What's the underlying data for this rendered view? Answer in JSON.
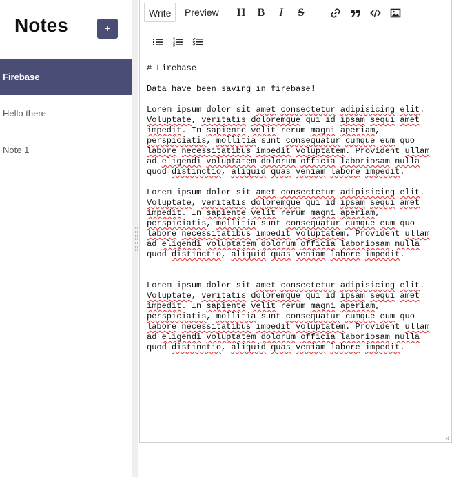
{
  "sidebar": {
    "title": "Notes",
    "add_label": "+",
    "notes": [
      {
        "label": "Firebase",
        "active": true
      },
      {
        "label": "Hello there",
        "active": false
      },
      {
        "label": "Note 1",
        "active": false
      }
    ]
  },
  "editor": {
    "tabs": [
      {
        "label": "Write",
        "active": true
      },
      {
        "label": "Preview",
        "active": false
      }
    ],
    "toolbar_icons": [
      "heading-icon",
      "bold-icon",
      "italic-icon",
      "strikethrough-icon",
      "link-icon",
      "quote-icon",
      "code-icon",
      "image-icon",
      "unordered-list-icon",
      "ordered-list-icon",
      "checked-list-icon"
    ],
    "toolbar_glyphs": {
      "heading": "H",
      "bold": "B",
      "italic": "I",
      "strike": "S"
    },
    "lines": [
      "# Firebase",
      "",
      "Data have been saving in firebase!",
      "",
      "Lorem ipsum dolor sit amet consectetur adipisicing elit.",
      "Voluptate, veritatis doloremque qui id ipsam sequi amet",
      "impedit. In sapiente velit rerum magni aperiam,",
      "perspiciatis, mollitia sunt consequatur cumque eum quo",
      "labore necessitatibus impedit voluptatem. Provident ullam",
      "ad eligendi voluptatem dolorum officia laboriosam nulla",
      "quod distinctio, aliquid quas veniam labore impedit.",
      "",
      "Lorem ipsum dolor sit amet consectetur adipisicing elit.",
      "Voluptate, veritatis doloremque qui id ipsam sequi amet",
      "impedit. In sapiente velit rerum magni aperiam,",
      "perspiciatis, mollitia sunt consequatur cumque eum quo",
      "labore necessitatibus impedit voluptatem. Provident ullam",
      "ad eligendi voluptatem dolorum officia laboriosam nulla",
      "quod distinctio, aliquid quas veniam labore impedit.",
      "",
      "",
      "Lorem ipsum dolor sit amet consectetur adipisicing elit.",
      "Voluptate, veritatis doloremque qui id ipsam sequi amet",
      "impedit. In sapiente velit rerum magni aperiam,",
      "perspiciatis, mollitia sunt consequatur cumque eum quo",
      "labore necessitatibus impedit voluptatem. Provident ullam",
      "ad eligendi voluptatem dolorum officia laboriosam nulla",
      "quod distinctio, aliquid quas veniam labore impedit."
    ],
    "misspelled": [
      "amet",
      "consectetur",
      "adipisicing",
      "elit",
      "Voluptate",
      "veritatis",
      "doloremque",
      "ipsam",
      "sequi",
      "impedit",
      "sapiente",
      "velit",
      "magni",
      "aperiam",
      "perspiciatis",
      "mollitia",
      "consequatur",
      "cumque",
      "eum",
      "labore",
      "necessitatibus",
      "voluptatem",
      "ullam",
      "eligendi",
      "dolorum",
      "officia",
      "laboriosam",
      "nulla",
      "distinctio",
      "aliquid",
      "quas",
      "veniam"
    ]
  },
  "colors": {
    "accent": "#4a4e74",
    "spellcheck": "#e03030"
  }
}
